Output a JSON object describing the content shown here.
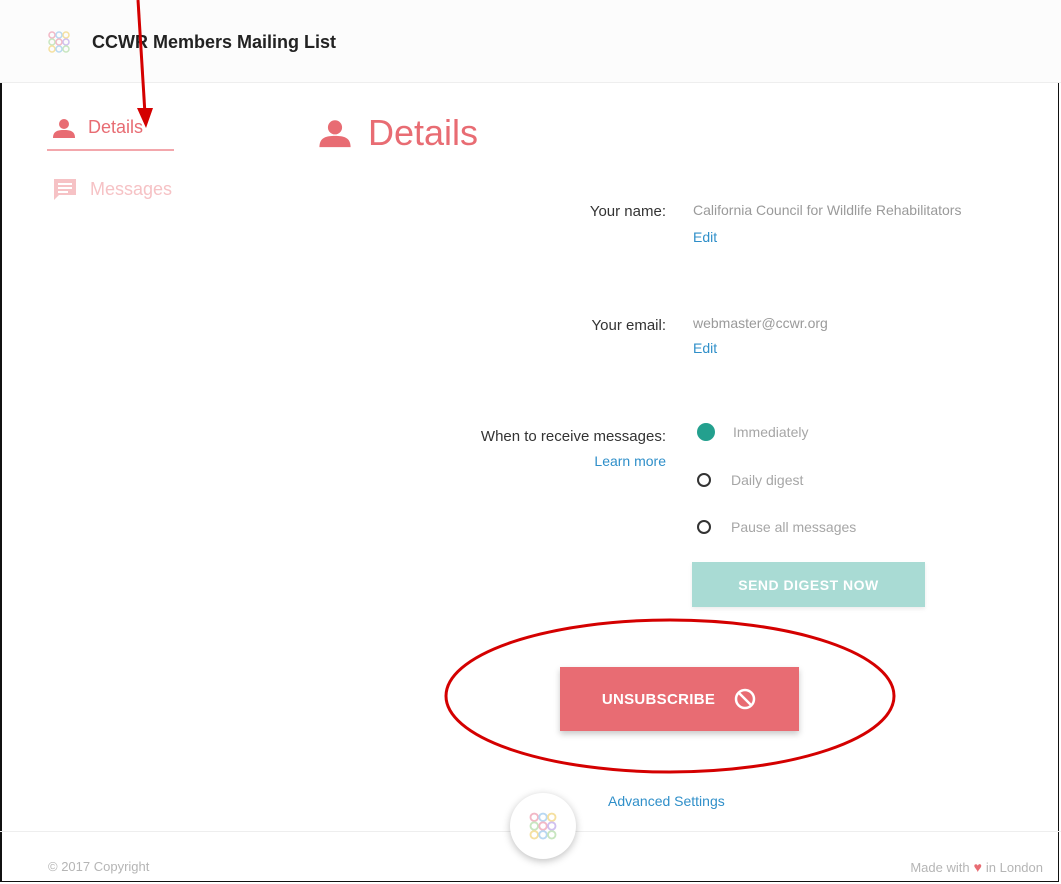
{
  "app": {
    "title": "CCWR Members Mailing List"
  },
  "sidebar": {
    "items": [
      {
        "label": "Details",
        "icon": "person-icon",
        "active": true
      },
      {
        "label": "Messages",
        "icon": "message-icon",
        "active": false
      }
    ]
  },
  "main": {
    "title": "Details",
    "name": {
      "label": "Your name:",
      "value": "California Council for Wildlife Rehabilitators",
      "edit": "Edit"
    },
    "email": {
      "label": "Your email:",
      "value": "webmaster@ccwr.org",
      "edit": "Edit"
    },
    "delivery": {
      "label": "When to receive messages:",
      "learn_more": "Learn more",
      "options": [
        "Immediately",
        "Daily digest",
        "Pause all messages"
      ],
      "selected": "Immediately"
    },
    "digest_button": "SEND DIGEST NOW",
    "unsubscribe_button": "UNSUBSCRIBE",
    "advanced_settings": "Advanced Settings"
  },
  "footer": {
    "copyright": "© 2017 Copyright",
    "made_with_prefix": "Made with",
    "made_with_suffix": "in London"
  },
  "colors": {
    "accent": "#e86c73",
    "teal": "#23a08e",
    "teal_light": "#a9dbd4",
    "link": "#2f8fc9",
    "annotation": "#d40000"
  }
}
